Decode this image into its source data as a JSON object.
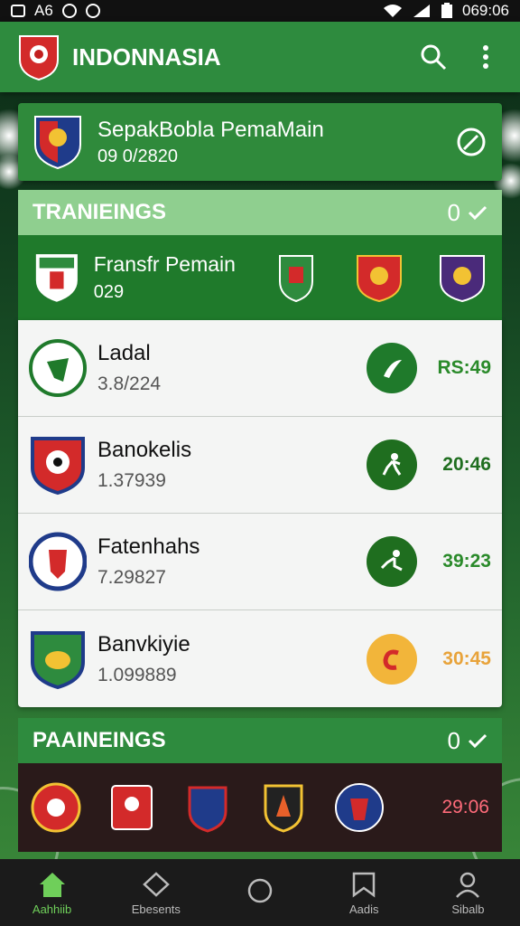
{
  "status_bar": {
    "left_text": "A6",
    "time": "069:06"
  },
  "app_bar": {
    "title": "INDONNASIA",
    "search_icon": "search-icon",
    "menu_icon": "more-vert-icon"
  },
  "featured": {
    "title": "SepakBobla PemaMain",
    "subtitle": "09 0/2820",
    "action_icon": "compass-icon"
  },
  "trainings": {
    "header": "TRANIEINGS",
    "count": "0",
    "transfer": {
      "title": "Fransfr Pemain",
      "sub": "029"
    },
    "items": [
      {
        "name": "Ladal",
        "value": "3.8/224",
        "time": "RS:49",
        "time_color": "#2a8a2a",
        "action_bg": "#1f7a2b"
      },
      {
        "name": "Banokelis",
        "value": "1.37939",
        "time": "20:46",
        "time_color": "#1f6e1f",
        "action_bg": "#1f6e1f"
      },
      {
        "name": "Fatenhahs",
        "value": "7.29827",
        "time": "39:23",
        "time_color": "#2a8a2a",
        "action_bg": "#1f6e1f"
      },
      {
        "name": "Banvkiyie",
        "value": "1.099889",
        "time": "30:45",
        "time_color": "#e8a33a",
        "action_bg": "#f2b53a"
      }
    ]
  },
  "painings": {
    "header": "PAAINEINGS",
    "count": "0",
    "time": "29:06"
  },
  "nav": {
    "home": "Aahhiib",
    "stats": "Ebesents",
    "circle": "",
    "news": "Aadis",
    "profile": "Sibalb"
  },
  "colors": {
    "primary_green": "#2e8b3e",
    "dark_green": "#1f7a2b",
    "accent_green": "#6fcf5a"
  }
}
